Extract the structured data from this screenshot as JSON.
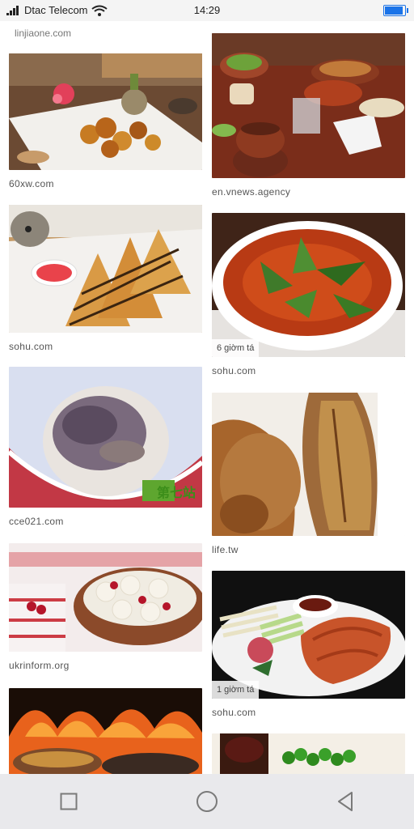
{
  "status_bar": {
    "carrier": "Dtac Telecom",
    "time": "14:29",
    "battery_level": 0.9
  },
  "feed": {
    "top_caption": "linjiaone.com",
    "left_column": [
      {
        "source": "60xw.com",
        "image": "sweet and sour pork dish"
      },
      {
        "source": "sohu.com",
        "image": "waffles with chocolate sauce"
      },
      {
        "source": "cce021.com",
        "image": "balut duck egg",
        "watermark": "第七站"
      },
      {
        "source": "ukrinform.org",
        "image": "dumplings with cherries"
      },
      {
        "source": "",
        "image": "grilled food over fire"
      }
    ],
    "right_column": [
      {
        "source": "en.vnews.agency",
        "image": "ukrainian dinner table"
      },
      {
        "source": "sohu.com",
        "image": "vietnamese soup with herbs",
        "badge": "6 giờm tá"
      },
      {
        "source": "life.tw",
        "image": "roasted duck close-up"
      },
      {
        "source": "sohu.com",
        "image": "peking duck plate",
        "badge": "1 giờm tá"
      },
      {
        "source": "",
        "image": "drinks and green peas"
      }
    ]
  },
  "nav": {
    "buttons": [
      "recents-button",
      "home-button",
      "back-button"
    ]
  }
}
